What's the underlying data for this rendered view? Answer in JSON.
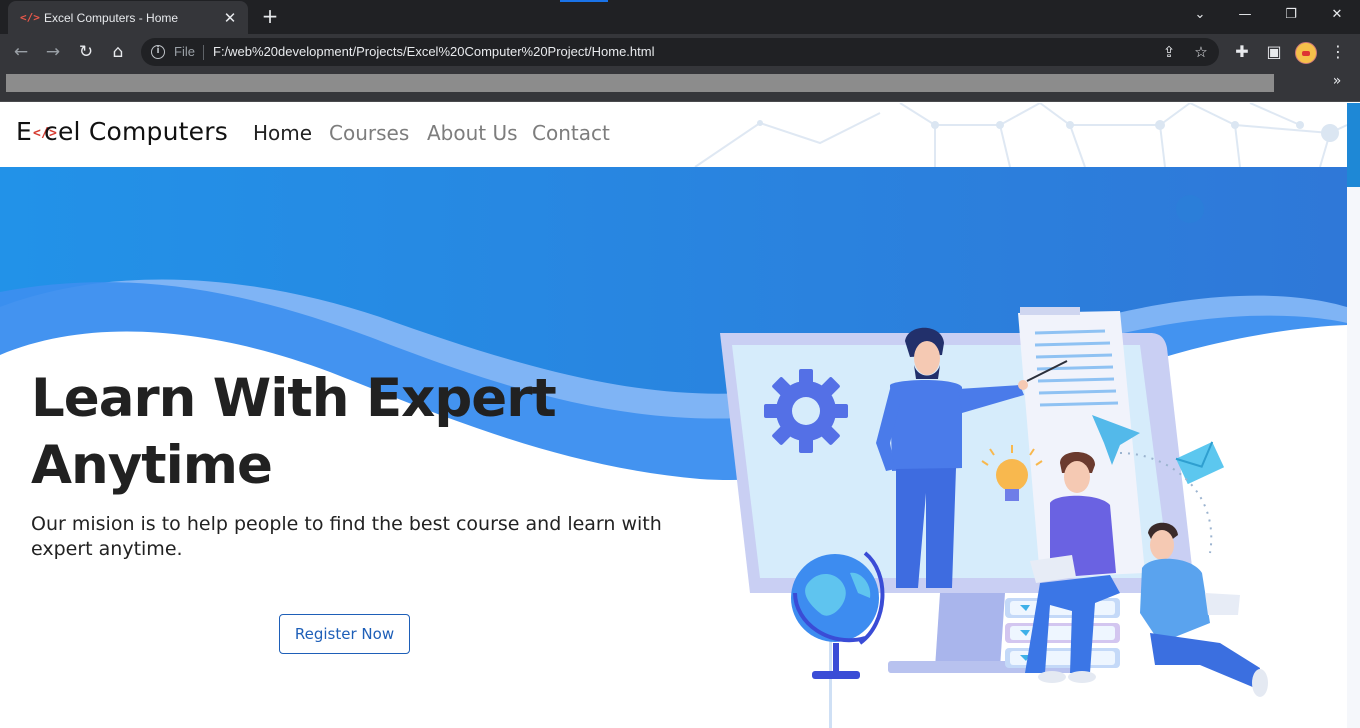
{
  "browser": {
    "tab_title": "Excel Computers - Home",
    "tab_favicon": "</>",
    "url_scheme": "File",
    "url": "F:/web%20development/Projects/Excel%20Computer%20Project/Home.html",
    "icons": [
      "back-icon",
      "forward-icon",
      "reload-icon",
      "home-icon",
      "info-icon",
      "share-icon",
      "star-icon",
      "extensions-icon",
      "side-panel-icon",
      "profile-avatar",
      "menu-icon",
      "chevron-down-icon",
      "minimize-icon",
      "restore-icon",
      "close-icon"
    ],
    "bookmarks_more": "»"
  },
  "site": {
    "brand": {
      "prefix": "E",
      "icon": "</>",
      "suffix": "cel Computers"
    },
    "nav": [
      {
        "label": "Home",
        "active": true
      },
      {
        "label": "Courses",
        "active": false
      },
      {
        "label": "About Us",
        "active": false
      },
      {
        "label": "Contact",
        "active": false
      }
    ],
    "hero": {
      "title": "Learn With Expert Anytime",
      "subtitle": "Our mision is to help people to find the best course and learn with expert anytime.",
      "cta": "Register Now"
    }
  },
  "colors": {
    "hero_blue": "#2a86e0",
    "wave_light": "#7fb4f5",
    "wave_mid": "#3d8ff0",
    "brand_icon": "#d63b30",
    "cta_border": "#1e5fb8",
    "illustration_accent": "#4a7bea"
  }
}
